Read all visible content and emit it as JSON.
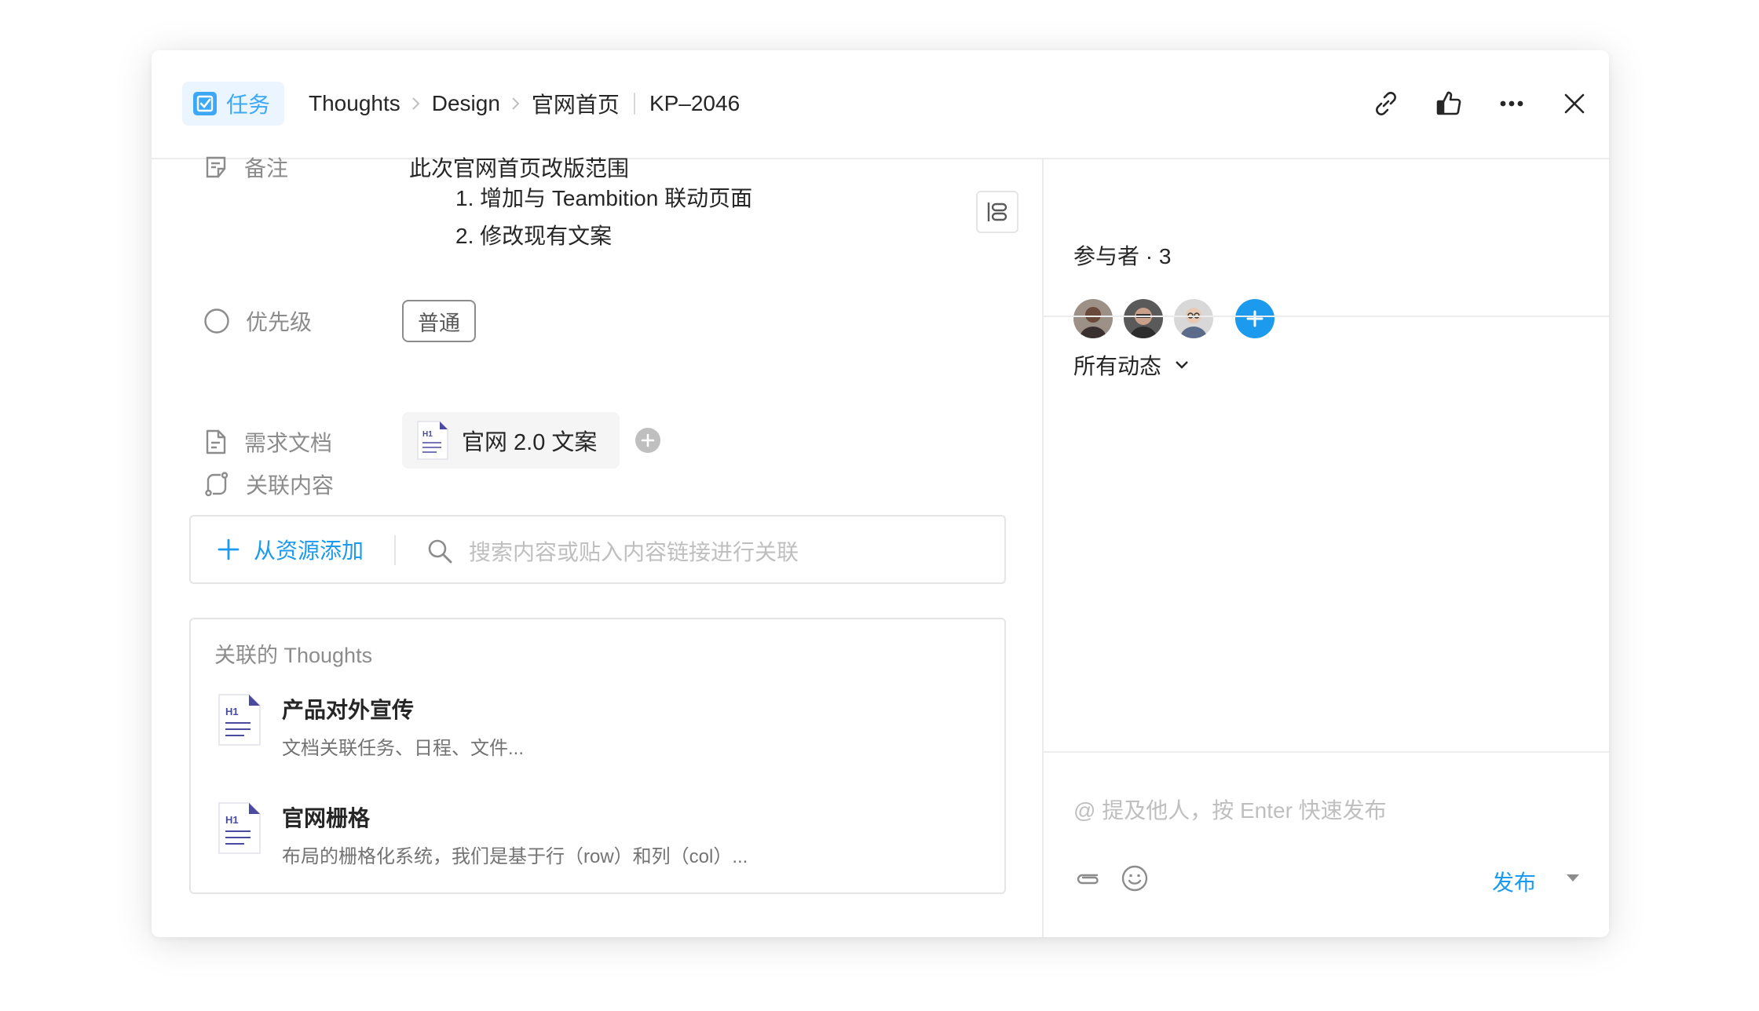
{
  "header": {
    "type_label": "任务",
    "crumbs": [
      "Thoughts",
      "Design",
      "官网首页"
    ],
    "task_id": "KP–2046"
  },
  "fields": {
    "note": {
      "label": "备注",
      "lines": [
        "此次官网首页改版范围",
        "1. 增加与 Teambition 联动页面",
        "2. 修改现有文案"
      ]
    },
    "priority": {
      "label": "优先级",
      "value": "普通"
    },
    "req_doc": {
      "label": "需求文档",
      "doc_title": "官网 2.0 文案",
      "doc_icon_text": "H1"
    },
    "related": {
      "label": "关联内容"
    }
  },
  "link_bar": {
    "add_label": "从资源添加",
    "search_placeholder": "搜索内容或贴入内容链接进行关联"
  },
  "related_thoughts": {
    "title": "关联的 Thoughts",
    "items": [
      {
        "title": "产品对外宣传",
        "desc": "文档关联任务、日程、文件...",
        "icon_text": "H1"
      },
      {
        "title": "官网栅格",
        "desc": "布局的栅格化系统，我们是基于行（row）和列（col）...",
        "icon_text": "H1"
      }
    ]
  },
  "sidebar": {
    "participants_label": "参与者 · 3",
    "activity_label": "所有动态",
    "comment_placeholder": "@ 提及他人，按 Enter 快速发布",
    "publish_label": "发布"
  },
  "colors": {
    "accent": "#1b9aee",
    "tag_bg": "#eaf5ff",
    "tag_fg": "#3da8f5",
    "doc_icon": "#4a4a9e"
  },
  "icons": [
    "task-icon",
    "chevron-right-icon",
    "link-icon",
    "thumbs-up-icon",
    "more-icon",
    "close-icon",
    "note-icon",
    "priority-circle-icon",
    "document-icon",
    "related-icon",
    "layout-icon",
    "plus-icon",
    "search-icon",
    "attachment-icon",
    "emoji-icon",
    "caret-down-icon",
    "chevron-down-icon"
  ]
}
